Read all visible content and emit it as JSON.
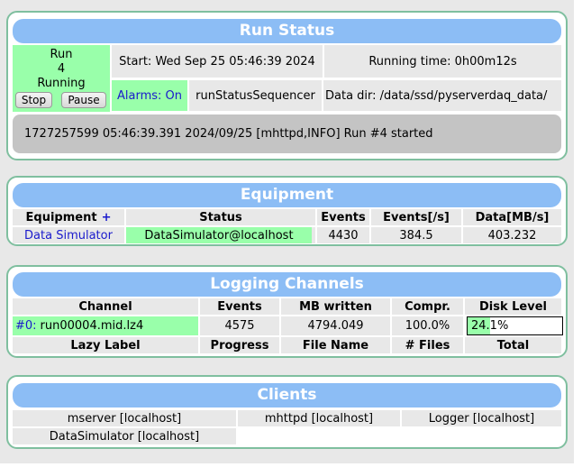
{
  "run_status": {
    "title": "Run Status",
    "run_label": "Run",
    "run_number": "4",
    "state": "Running",
    "stop_label": "Stop",
    "pause_label": "Pause",
    "start": "Start: Wed Sep 25 05:46:39 2024",
    "running_time": "Running time: 0h00m12s",
    "alarms": "Alarms: On",
    "sequencer": "runStatusSequencer",
    "data_dir": "Data dir: /data/ssd/pyserverdaq_data/",
    "message": "1727257599 05:46:39.391 2024/09/25 [mhttpd,INFO] Run #4 started"
  },
  "equipment": {
    "title": "Equipment",
    "headers": {
      "equipment": "Equipment",
      "add": "+",
      "status": "Status",
      "events": "Events",
      "rate": "Events[/s]",
      "data": "Data[MB/s]"
    },
    "rows": [
      {
        "name": "Data Simulator",
        "status": "DataSimulator@localhost",
        "events": "4430",
        "rate": "384.5",
        "data": "403.232"
      }
    ]
  },
  "logging": {
    "title": "Logging Channels",
    "headers": {
      "channel": "Channel",
      "events": "Events",
      "mb": "MB written",
      "compr": "Compr.",
      "disk": "Disk Level"
    },
    "rows": [
      {
        "channel_id": "#0:",
        "file": "run00004.mid.lz4",
        "events": "4575",
        "mb": "4794.049",
        "compr": "100.0%",
        "disk": "24.1%",
        "disk_fraction": 0.241
      }
    ],
    "lazy_headers": {
      "label": "Lazy Label",
      "progress": "Progress",
      "file": "File Name",
      "files": "# Files",
      "total": "Total"
    }
  },
  "clients": {
    "title": "Clients",
    "items": [
      "mserver [localhost]",
      "mhttpd [localhost]",
      "Logger [localhost]",
      "DataSimulator [localhost]"
    ]
  },
  "colors": {
    "header_blue": "#8cbdf5",
    "status_green": "#99ffaa",
    "panel_border": "#7fbf9f",
    "link_blue": "#1a1acc"
  }
}
